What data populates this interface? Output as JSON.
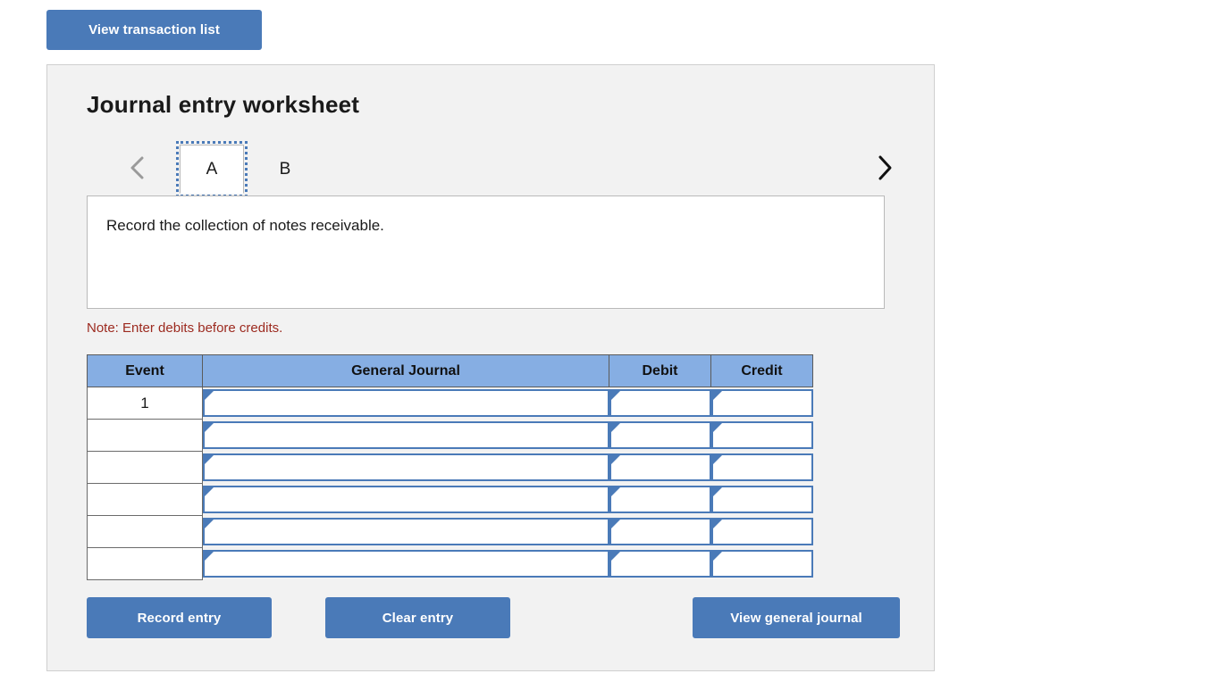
{
  "top": {
    "view_transaction_list": "View transaction list"
  },
  "panel": {
    "title": "Journal entry worksheet",
    "tabs": [
      {
        "label": "A",
        "selected": true
      },
      {
        "label": "B",
        "selected": false
      }
    ],
    "nav": {
      "prev_icon": "chevron-left-icon",
      "next_icon": "chevron-right-icon"
    },
    "description": "Record the collection of notes receivable.",
    "note": "Note: Enter debits before credits."
  },
  "table": {
    "headers": {
      "event": "Event",
      "general_journal": "General Journal",
      "debit": "Debit",
      "credit": "Credit"
    },
    "rows": [
      {
        "event": "1",
        "general_journal": "",
        "debit": "",
        "credit": ""
      },
      {
        "event": "",
        "general_journal": "",
        "debit": "",
        "credit": ""
      },
      {
        "event": "",
        "general_journal": "",
        "debit": "",
        "credit": ""
      },
      {
        "event": "",
        "general_journal": "",
        "debit": "",
        "credit": ""
      },
      {
        "event": "",
        "general_journal": "",
        "debit": "",
        "credit": ""
      },
      {
        "event": "",
        "general_journal": "",
        "debit": "",
        "credit": ""
      }
    ]
  },
  "buttons": {
    "record_entry": "Record entry",
    "clear_entry": "Clear entry",
    "view_general_journal": "View general journal"
  },
  "colors": {
    "button_blue": "#4a7ab8",
    "header_blue": "#86aee3",
    "note_red": "#9c2a1f",
    "panel_bg": "#f2f2f2",
    "panel_border": "#cfcfcf"
  }
}
